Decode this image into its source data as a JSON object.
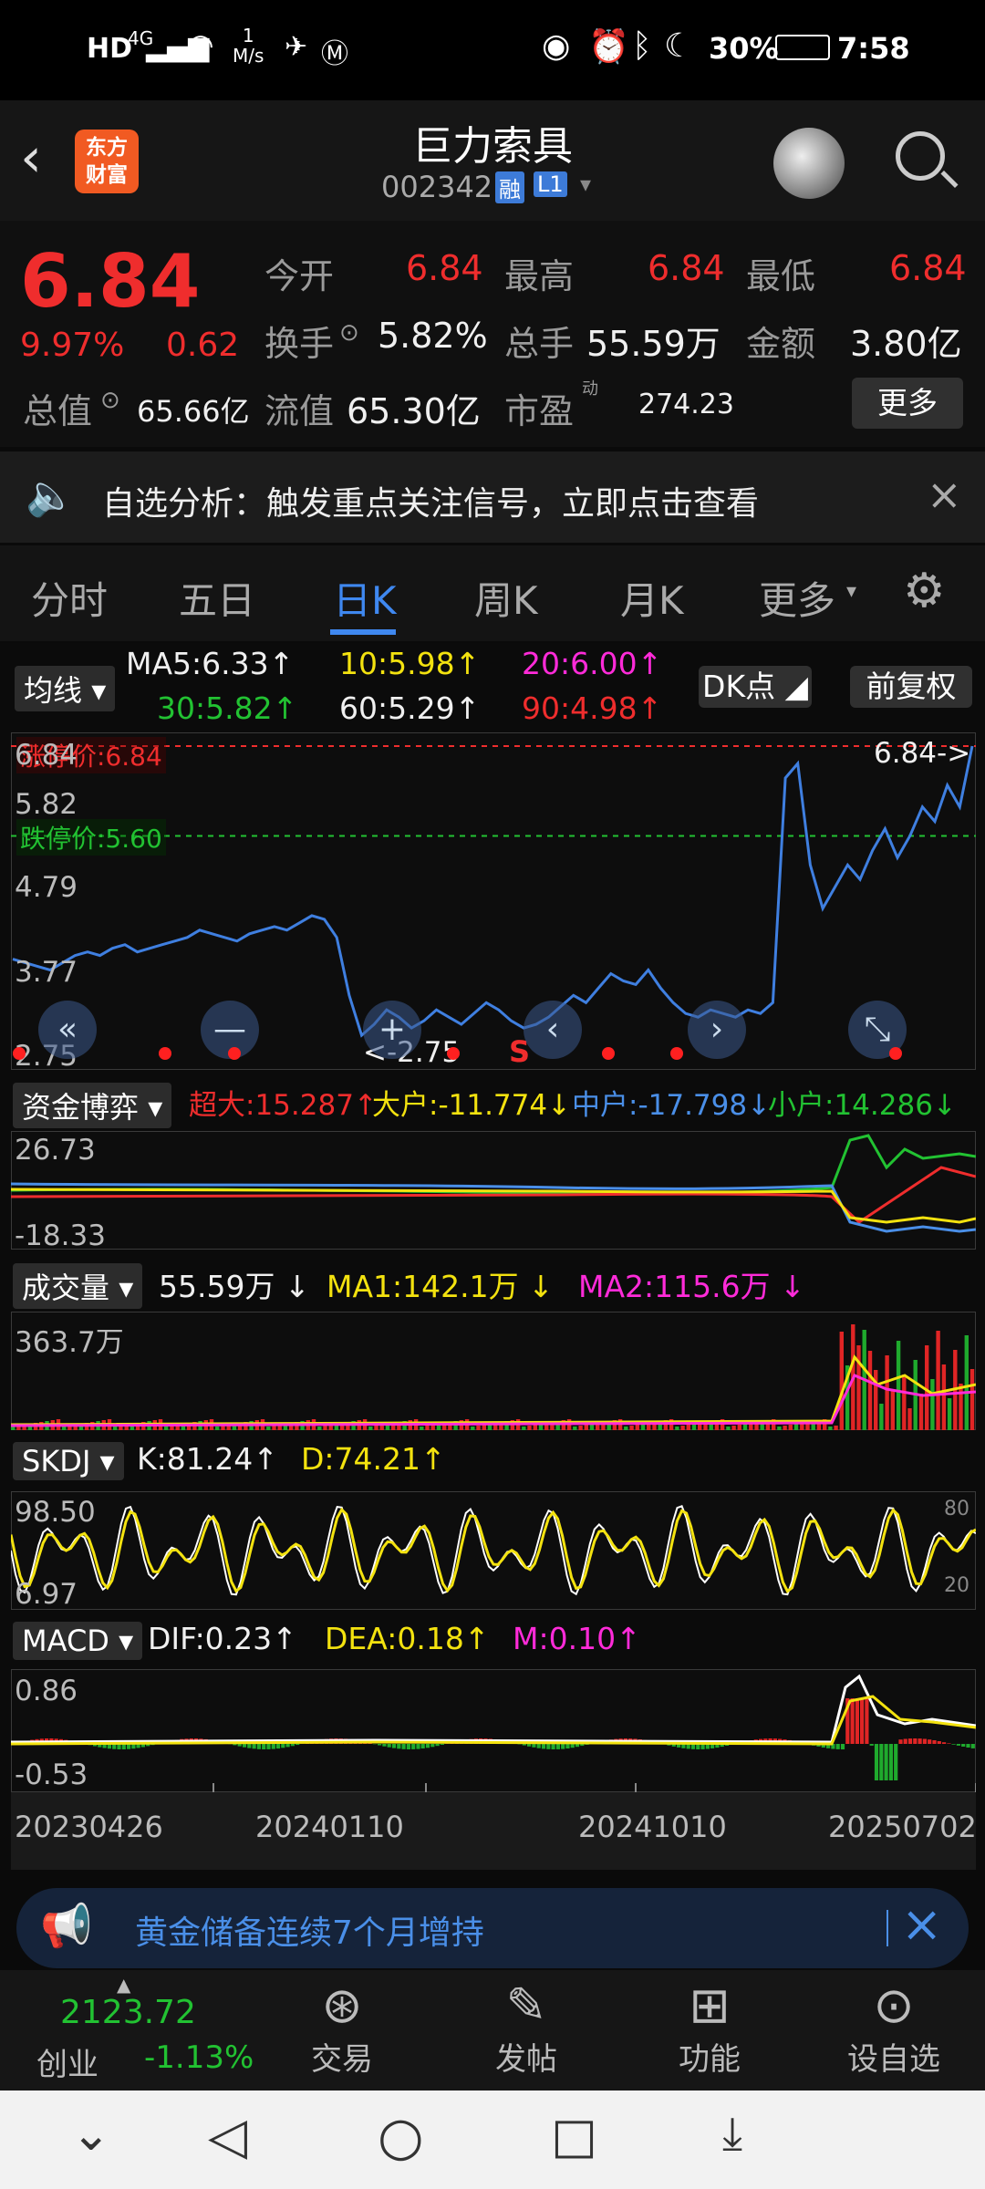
{
  "status_bar": {
    "net_speed": "1\nM/s",
    "net_type": "4G",
    "battery": "30%",
    "time": "7:58"
  },
  "header": {
    "title": "巨力索具",
    "code": "002342",
    "badge_rong": "融",
    "badge_l1": "L1",
    "logo_line1": "东方",
    "logo_line2": "财富"
  },
  "quote": {
    "price": "6.84",
    "change_pct": "9.97%",
    "change": "0.62",
    "open_label": "今开",
    "open": "6.84",
    "high_label": "最高",
    "high": "6.84",
    "low_label": "最低",
    "low": "6.84",
    "turnover_label": "换手",
    "turnover": "5.82%",
    "volume_label": "总手",
    "volume": "55.59万",
    "amount_label": "金额",
    "amount": "3.80亿",
    "mcap_label": "总值",
    "mcap": "65.66亿",
    "float_label": "流值",
    "float": "65.30亿",
    "pe_label": "市盈",
    "pe_sup": "动",
    "pe": "274.23",
    "more": "更多"
  },
  "notice": {
    "text": "自选分析：触发重点关注信号，立即点击查看"
  },
  "tabs": [
    {
      "label": "分时"
    },
    {
      "label": "五日"
    },
    {
      "label": "日K"
    },
    {
      "label": "周K"
    },
    {
      "label": "月K"
    },
    {
      "label": "更多"
    }
  ],
  "ma_bar": {
    "selector": "均线",
    "ma5": "MA5:6.33",
    "ma10": "10:5.98",
    "ma20": "20:6.00",
    "ma30": "30:5.82",
    "ma60": "60:5.29",
    "ma90": "90:4.98",
    "dk": "DK点",
    "fq": "前复权"
  },
  "main_chart": {
    "limit_up": "涨停价:6.84",
    "limit_down": "跌停价:5.60",
    "y_labels": [
      "6.84",
      "5.82",
      "4.79",
      "3.77",
      "2.75"
    ],
    "last_label": "6.84->",
    "min_label": "<-2.75",
    "sell_marker": "S"
  },
  "capital": {
    "selector": "资金博弈",
    "super": "超大:15.287",
    "large": "大户:-11.774",
    "mid": "中户:-17.798",
    "small": "小户:14.286",
    "ymax": "26.73",
    "ymin": "-18.33"
  },
  "volume": {
    "selector": "成交量",
    "value": "55.59万",
    "ma1": "MA1:142.1万",
    "ma2": "MA2:115.6万",
    "ymax": "363.7万"
  },
  "skdj": {
    "selector": "SKDJ",
    "k": "K:81.24",
    "d": "D:74.21",
    "ymax": "98.50",
    "ymin": "6.97",
    "r80": "80",
    "r20": "20"
  },
  "macd": {
    "selector": "MACD",
    "dif": "DIF:0.23",
    "dea": "DEA:0.18",
    "m": "M:0.10",
    "ymax": "0.86",
    "ymin": "-0.53"
  },
  "dates": [
    "20230426",
    "20240110",
    "20241010",
    "20250702"
  ],
  "news": {
    "text": "黄金储备连续7个月增持"
  },
  "bottom_nav": {
    "index_value": "2123.72",
    "index_name": "创业",
    "index_change": "-1.13%",
    "items": [
      "交易",
      "发帖",
      "功能",
      "设自选"
    ]
  },
  "chart_data": [
    {
      "type": "line",
      "name": "price",
      "ylim": [
        2.75,
        6.84
      ],
      "values": [
        3.9,
        3.85,
        3.8,
        3.75,
        3.85,
        3.95,
        4.0,
        3.95,
        4.05,
        4.1,
        4.0,
        4.05,
        4.1,
        4.15,
        4.2,
        4.3,
        4.25,
        4.2,
        4.15,
        4.25,
        4.3,
        4.35,
        4.3,
        4.4,
        4.5,
        4.45,
        4.2,
        3.4,
        2.85,
        3.0,
        3.2,
        3.1,
        2.95,
        3.05,
        3.2,
        3.1,
        3.0,
        3.15,
        3.3,
        3.2,
        3.05,
        2.95,
        3.0,
        3.1,
        3.25,
        3.4,
        3.3,
        3.5,
        3.7,
        3.6,
        3.55,
        3.75,
        3.5,
        3.3,
        3.15,
        3.1,
        3.2,
        3.15,
        3.1,
        3.2,
        3.15,
        3.3,
        6.4,
        6.6,
        5.2,
        4.6,
        4.9,
        5.2,
        5.0,
        5.4,
        5.7,
        5.3,
        5.6,
        6.0,
        5.8,
        6.3,
        6.0,
        6.84
      ]
    }
  ]
}
